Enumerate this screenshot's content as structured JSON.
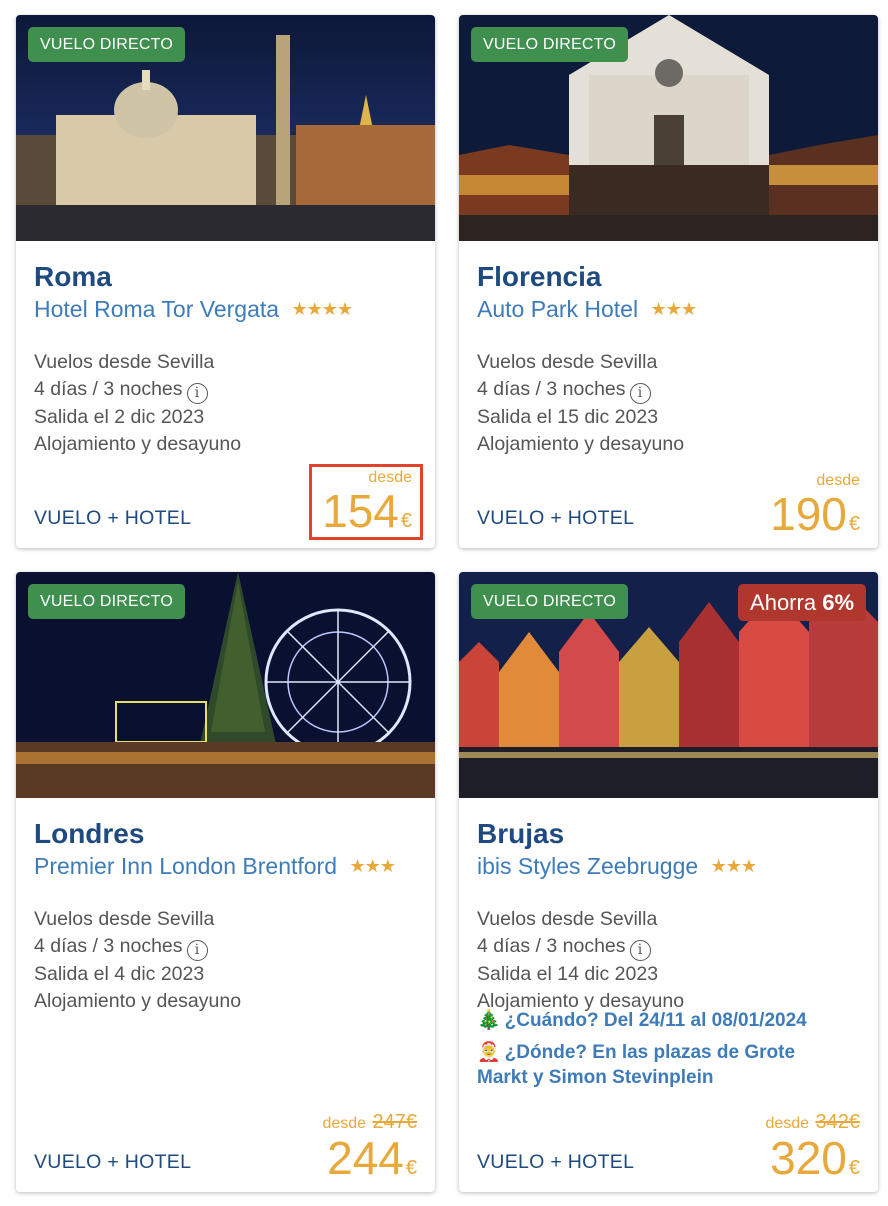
{
  "cards": [
    {
      "badge": "VUELO DIRECTO",
      "city": "Roma",
      "hotel": "Hotel Roma Tor Vergata",
      "stars": "★★★★",
      "departure": "Vuelos desde Sevilla",
      "duration": "4 días / 3 noches",
      "date": "Salida el 2 dic 2023",
      "board": "Alojamiento y desayuno",
      "product": "VUELO + HOTEL",
      "desde": "desde",
      "price": "154",
      "currency": "€"
    },
    {
      "badge": "VUELO DIRECTO",
      "city": "Florencia",
      "hotel": "Auto Park Hotel",
      "stars": "★★★",
      "departure": "Vuelos desde Sevilla",
      "duration": "4 días / 3 noches",
      "date": "Salida el 15 dic 2023",
      "board": "Alojamiento y desayuno",
      "product": "VUELO + HOTEL",
      "desde": "desde",
      "price": "190",
      "currency": "€"
    },
    {
      "badge": "VUELO DIRECTO",
      "city": "Londres",
      "hotel": "Premier Inn London Brentford",
      "stars": "★★★",
      "departure": "Vuelos desde Sevilla",
      "duration": "4 días / 3 noches",
      "date": "Salida el 4 dic 2023",
      "board": "Alojamiento y desayuno",
      "product": "VUELO + HOTEL",
      "desde": "desde",
      "old_price": "247€",
      "price": "244",
      "currency": "€"
    },
    {
      "badge": "VUELO DIRECTO",
      "save_label": "Ahorra",
      "save_pct": "6%",
      "city": "Brujas",
      "hotel": "ibis Styles Zeebrugge",
      "stars": "★★★",
      "departure": "Vuelos desde Sevilla",
      "duration": "4 días / 3 noches",
      "date": "Salida el 14 dic 2023",
      "board": "Alojamiento y desayuno",
      "promo_when_emoji": "🎄",
      "promo_when": "¿Cuándo? Del 24/11 al 08/01/2024",
      "promo_where_emoji": "🤶",
      "promo_where": "¿Dónde? En las plazas de Grote Markt y Simon Stevinplein",
      "product": "VUELO + HOTEL",
      "desde": "desde",
      "old_price": "342€",
      "price": "320",
      "currency": "€"
    }
  ],
  "icons": {
    "info": "i",
    "star": "star-icon"
  },
  "colors": {
    "direct_badge": "#3f8f4f",
    "save_badge": "#b0372e",
    "city": "#1e4a7f",
    "hotel": "#3e7cb9",
    "price": "#e8a93a",
    "highlight": "#e2432c"
  }
}
